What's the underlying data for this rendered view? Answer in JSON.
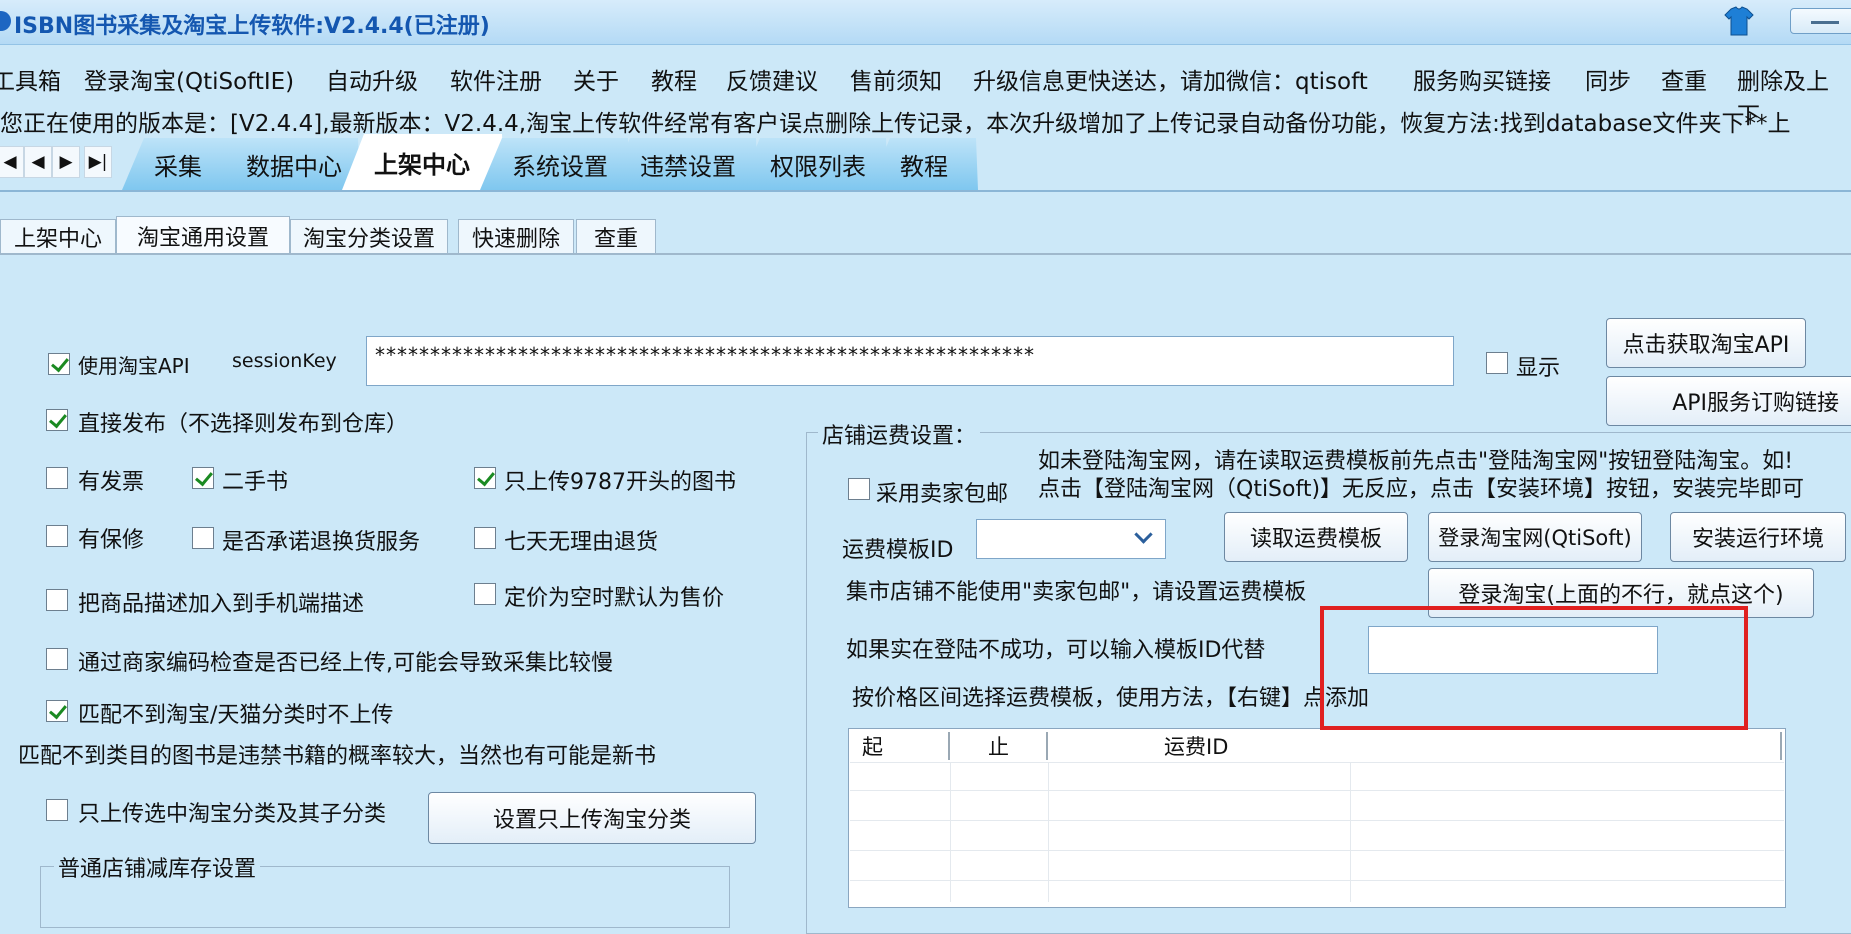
{
  "window": {
    "title": "ISBN图书采集及淘宝上传软件:V2.4.4(已注册)"
  },
  "menu": {
    "items": [
      "工具箱",
      "登录淘宝(QtiSoftIE)",
      "自动升级",
      "软件注册",
      "关于",
      "教程",
      "反馈建议",
      "售前须知",
      "升级信息更快送达，请加微信：qtisoft",
      "服务购买链接",
      "同步",
      "查重",
      "删除及上下"
    ]
  },
  "notice": "您正在使用的版本是：[V2.4.4],最新版本：V2.4.4,淘宝上传软件经常有客户误点删除上传记录，本次升级增加了上传记录自动备份功能，恢复方法:找到database文件夹下**上",
  "main_tabs": [
    "采集",
    "数据中心",
    "上架中心",
    "系统设置",
    "违禁设置",
    "权限列表",
    "教程"
  ],
  "sub_tabs": [
    "上架中心",
    "淘宝通用设置",
    "淘宝分类设置",
    "快速删除",
    "查重"
  ],
  "api": {
    "use_api_label": "使用淘宝API",
    "session_key_label": "sessionKey",
    "session_key_value": "************************************************************",
    "show_label": "显示",
    "get_api_button": "点击获取淘宝API",
    "subscribe_button": "API服务订购链接"
  },
  "options": {
    "direct_publish": "直接发布（不选择则发布到仓库）",
    "invoice": "有发票",
    "second_hand": "二手书",
    "only_9787": "只上传9787开头的图书",
    "warranty": "有保修",
    "return_exchange": "是否承诺退换货服务",
    "seven_day": "七天无理由退货",
    "mobile_desc": "把商品描述加入到手机端描述",
    "price_default": "定价为空时默认为售价",
    "merchant_code_check": "通过商家编码检查是否已经上传,可能会导致采集比较慢",
    "no_upload_unmatched": "匹配不到淘宝/天猫分类时不上传",
    "unmatched_note": "匹配不到类目的图书是违禁书籍的概率较大，当然也有可能是新书",
    "only_selected_category": "只上传选中淘宝分类及其子分类",
    "set_category_button": "设置只上传淘宝分类"
  },
  "stock_group": {
    "title": "普通店铺减库存设置"
  },
  "shipping": {
    "group_title": "店铺运费设置：",
    "hint_line1": "如未登陆淘宝网，请在读取运费模板前先点击\"登陆淘宝网\"按钮登陆淘宝。如!",
    "hint_line2": "点击【登陆淘宝网（QtiSoft)】无反应，点击【安装环境】按钮，安装完毕即可",
    "seller_free_label": "采用卖家包邮",
    "template_id_label": "运费模板ID",
    "read_template_button": "读取运费模板",
    "login_qtisoft_button": "登录淘宝网(QtiSoft)",
    "install_env_button": "安装运行环境",
    "market_note": "集市店铺不能使用\"卖家包邮\"，请设置运费模板",
    "login_alt_button": "登录淘宝(上面的不行，就点这个)",
    "manual_id_label": "如果实在登陆不成功，可以输入模板ID代替",
    "price_range_note": "按价格区间选择运费模板，使用方法，【右键】点添加",
    "table_columns": [
      "起",
      "止",
      "运费ID"
    ]
  },
  "colors": {
    "background": "#cce8f8",
    "title_text": "#1457b0",
    "tab_active": "#ffffff",
    "tab_inactive": "#7fc7ef",
    "check_mark": "#1b8a22",
    "highlight_box": "#e02020"
  }
}
